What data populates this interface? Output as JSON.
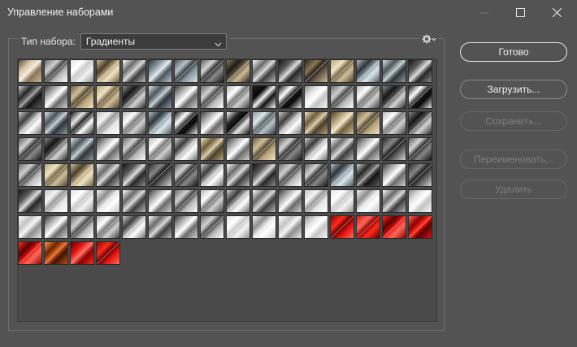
{
  "window": {
    "title": "Управление наборами"
  },
  "set_type": {
    "label": "Тип набора:",
    "selected": "Градиенты"
  },
  "buttons": {
    "done": "Готово",
    "load": "Загрузить...",
    "save": "Сохранить...",
    "rename": "Переименовать...",
    "delete": "Удалить"
  },
  "icons": {
    "minimize": "minimize-icon",
    "maximize": "maximize-icon",
    "close": "close-icon",
    "dropdown": "chevron-down-icon",
    "settings": "gear-icon"
  },
  "colors": {
    "background": "#535353",
    "grid_background": "#4a4a4a",
    "red_gradient": "#d41010"
  },
  "swatches": {
    "total_count": 116,
    "rows": [
      [
        "sand",
        "silver",
        "white",
        "gold",
        "silver",
        "steel",
        "steel",
        "dark",
        "brown",
        "silver",
        "dark",
        "brown",
        "gold",
        "steel",
        "steel",
        "dark"
      ],
      [
        "dark",
        "silver",
        "gold",
        "gold",
        "dark",
        "steel",
        "silver",
        "silver",
        "silver",
        "black",
        "black",
        "white",
        "silver",
        "silver",
        "dark",
        "black"
      ],
      [
        "silver",
        "steel",
        "black",
        "white",
        "silver",
        "steel",
        "black",
        "silver",
        "black",
        "steel",
        "silver",
        "gold",
        "gold",
        "gold",
        "silver",
        "dark"
      ],
      [
        "dark",
        "dark",
        "steel",
        "silver",
        "silver",
        "silver",
        "silver",
        "gold",
        "silver",
        "gold",
        "dark",
        "silver",
        "silver",
        "silver",
        "dark",
        "dark"
      ],
      [
        "silver",
        "gold",
        "gold",
        "silver",
        "dark",
        "dark",
        "dark",
        "silver",
        "silver",
        "dark",
        "silver",
        "dark",
        "steel",
        "dark",
        "silver",
        "dark"
      ],
      [
        "dark",
        "white",
        "white",
        "white",
        "silver",
        "silver",
        "silver",
        "silver",
        "silver",
        "silver",
        "silver",
        "white",
        "white",
        "white",
        "silver",
        "white"
      ],
      [
        "white",
        "silver",
        "silver",
        "silver",
        "silver",
        "silver",
        "silver",
        "silver",
        "white",
        "white",
        "white",
        "white",
        "red",
        "red",
        "red",
        "red"
      ],
      [
        "red",
        "orange",
        "red",
        "red"
      ]
    ]
  }
}
